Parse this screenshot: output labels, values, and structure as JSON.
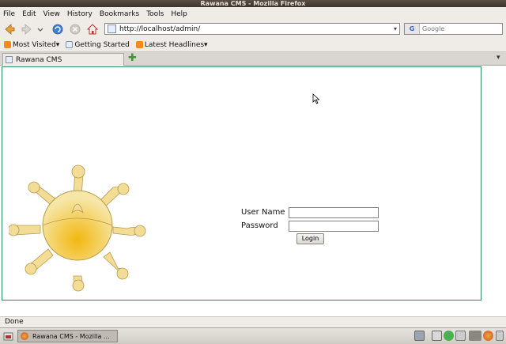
{
  "window": {
    "title": "Rawana CMS - Mozilla Firefox"
  },
  "menu": [
    "File",
    "Edit",
    "View",
    "History",
    "Bookmarks",
    "Tools",
    "Help"
  ],
  "nav": {
    "url": "http://localhost/admin/",
    "search_placeholder": "Google",
    "search_engine": "G"
  },
  "bookmarks": [
    {
      "label": "Most Visited",
      "has_dropdown": true,
      "icon": "rss-icon"
    },
    {
      "label": "Getting Started",
      "has_dropdown": false,
      "icon": "page-icon"
    },
    {
      "label": "Latest Headlines",
      "has_dropdown": true,
      "icon": "rss-icon"
    }
  ],
  "tab": {
    "label": "Rawana CMS"
  },
  "login": {
    "username_label": "User Name",
    "password_label": "Password",
    "username_value": "",
    "password_value": "",
    "button_label": "Login"
  },
  "status": {
    "text": "Done"
  },
  "taskbar": {
    "item_label": "Rawana CMS - Mozilla ..."
  },
  "colors": {
    "frame_border": "#2e8b57",
    "logo_fill": "#f2c94c"
  }
}
